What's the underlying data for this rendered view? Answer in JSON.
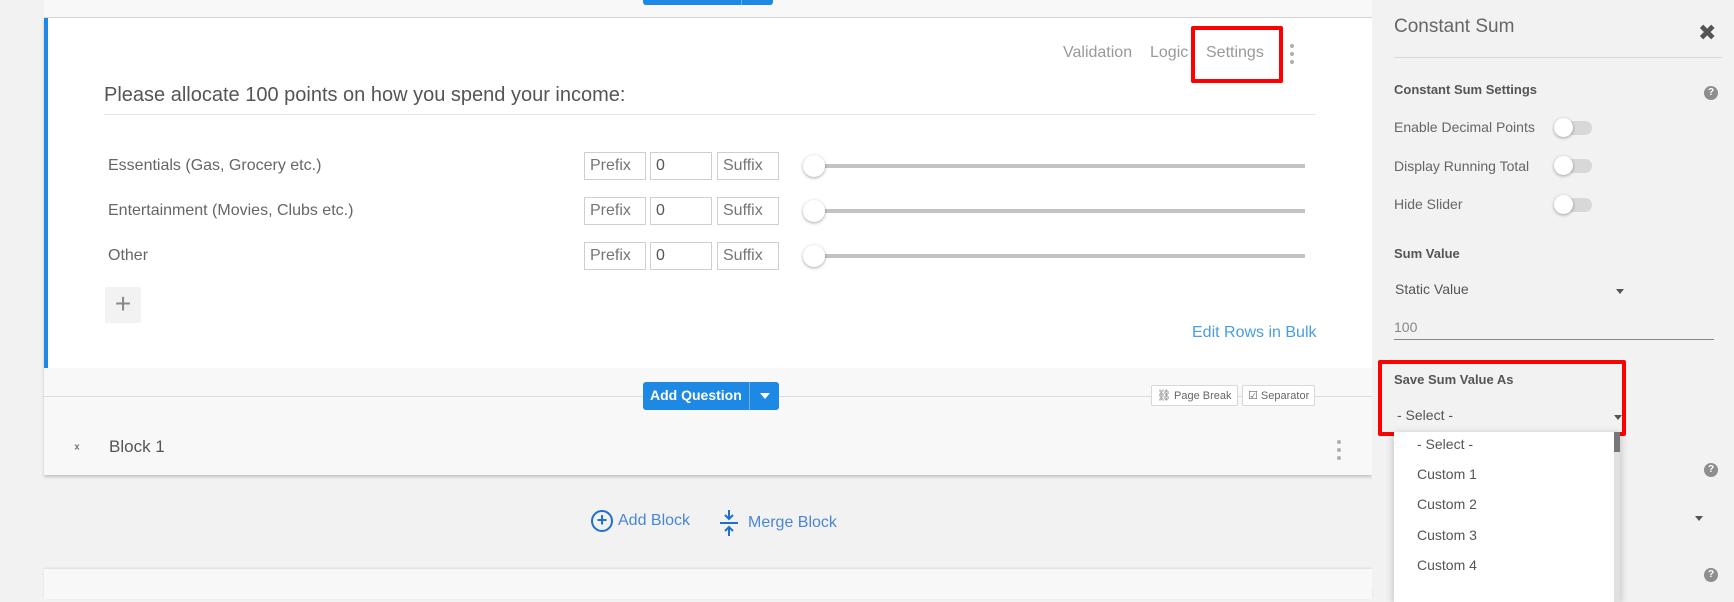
{
  "question": {
    "tabs": [
      "Validation",
      "Logic",
      "Settings"
    ],
    "title": "Please allocate 100 points on how you spend your income:",
    "rows": [
      {
        "label": "Essentials (Gas, Grocery etc.)",
        "prefix_placeholder": "Prefix",
        "value": "0",
        "suffix_placeholder": "Suffix",
        "slider_value": 0
      },
      {
        "label": "Entertainment (Movies, Clubs etc.)",
        "prefix_placeholder": "Prefix",
        "value": "0",
        "suffix_placeholder": "Suffix",
        "slider_value": 0
      },
      {
        "label": "Other",
        "prefix_placeholder": "Prefix",
        "value": "0",
        "suffix_placeholder": "Suffix",
        "slider_value": 0
      }
    ],
    "add_row_icon": "+",
    "edit_rows_bulk": "Edit Rows in Bulk"
  },
  "toolbar": {
    "add_question": "Add Question",
    "page_break": "Page Break",
    "separator": "Separator"
  },
  "blocks": {
    "block1_title": "Block 1",
    "add_block": "Add Block",
    "merge_block": "Merge Block"
  },
  "panel": {
    "title": "Constant Sum",
    "close_icon": "✖",
    "settings_heading": "Constant Sum Settings",
    "toggles": [
      {
        "label": "Enable Decimal Points",
        "on": false
      },
      {
        "label": "Display Running Total",
        "on": false
      },
      {
        "label": "Hide Slider",
        "on": false
      }
    ],
    "sum_value_heading": "Sum Value",
    "sum_value_type": "Static Value",
    "sum_value": "100",
    "save_as_heading": "Save Sum Value As",
    "save_as_selected": "- Select -",
    "save_as_options": [
      "- Select -",
      "Custom 1",
      "Custom 2",
      "Custom 3",
      "Custom 4"
    ]
  },
  "colors": {
    "accent": "#1e88e5",
    "highlight": "#ff0000",
    "link": "#4a9de0"
  }
}
